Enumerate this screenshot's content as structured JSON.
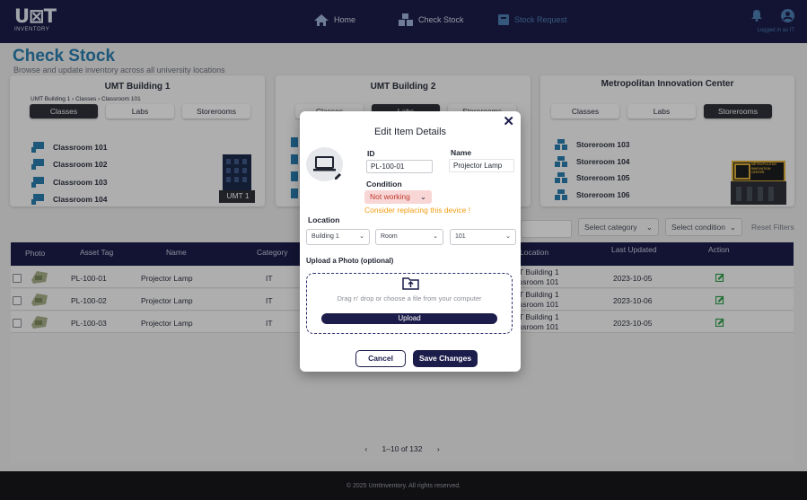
{
  "brand": {
    "logo_mark": "U⊠T",
    "logo_sub": "INVENTORY"
  },
  "nav": {
    "items": [
      {
        "label": "Home",
        "icon": "home-icon"
      },
      {
        "label": "Check Stock",
        "icon": "boxes-icon"
      },
      {
        "label": "Stock Request",
        "icon": "inbox-icon"
      }
    ],
    "logged_in": "Logged in as IT"
  },
  "page": {
    "title": "Check Stock",
    "subtitle": "Browse and update inventory across all university locations"
  },
  "buildings": [
    {
      "title": "UMT Building 1",
      "breadcrumb": "UMT Building 1 › Classes › Classroom 101",
      "tabs": [
        "Classes",
        "Labs",
        "Storerooms"
      ],
      "active_tab": "Classes",
      "rooms": [
        "Classroom 101",
        "Classroom 102",
        "Classroom 103",
        "Classroom 104"
      ],
      "image_label": "UMT 1"
    },
    {
      "title": "UMT Building 2",
      "tabs": [
        "Classes",
        "Labs",
        "Storerooms"
      ],
      "active_tab": "Labs"
    },
    {
      "title": "Metropolitan Innovation Center",
      "tabs": [
        "Classes",
        "Labs",
        "Storerooms"
      ],
      "active_tab": "Storerooms",
      "rooms": [
        "Storeroom 103",
        "Storeroom 104",
        "Storeroom 105",
        "Storeroom 106"
      ],
      "image_label": "METROPOLITAN INNOVATION CENTER"
    }
  ],
  "filters": {
    "category": "Select category",
    "condition": "Select condition",
    "reset": "Reset Filters"
  },
  "table": {
    "headers": [
      "Photo",
      "Asset Tag",
      "Name",
      "Category",
      "Location",
      "Last Updated",
      "Action"
    ],
    "rows": [
      {
        "tag": "PL-100-01",
        "name": "Projector Lamp",
        "category": "IT",
        "loc1": "T Building 1",
        "loc2": "ssroom 101",
        "updated": "2023-10-05"
      },
      {
        "tag": "PL-100-02",
        "name": "Projector Lamp",
        "category": "IT",
        "loc1": "T Building 1",
        "loc2": "ssroom 101",
        "updated": "2023-10-06"
      },
      {
        "tag": "PL-100-03",
        "name": "Projector Lamp",
        "category": "IT",
        "loc1": "T Building 1",
        "loc2": "ssroom 101",
        "updated": "2023-10-05"
      }
    ],
    "pagination": {
      "prev": "‹",
      "range": "1–10 of 132",
      "next": "›"
    }
  },
  "footer": "© 2025 UmtInventory. All rights reserved.",
  "modal": {
    "title": "Edit Item Details",
    "close": "✕",
    "id_label": "ID",
    "id_value": "PL-100-01",
    "name_label": "Name",
    "name_value": "Projector Lamp",
    "condition_label": "Condition",
    "condition_value": "Not working",
    "warning": "Consider replacing this device !",
    "location_label": "Location",
    "building": "Building 1",
    "room": "Room",
    "room_number": "101",
    "upload_label": "Upload a Photo (optional)",
    "drop_text": "Drag n' drop or choose a file from your computer",
    "upload_button": "Upload",
    "cancel": "Cancel",
    "save": "Save Changes"
  },
  "colors": {
    "navy": "#1c1d4a",
    "accent": "#2a7fb0",
    "warning": "#f39c12",
    "danger": "#c0392b"
  }
}
